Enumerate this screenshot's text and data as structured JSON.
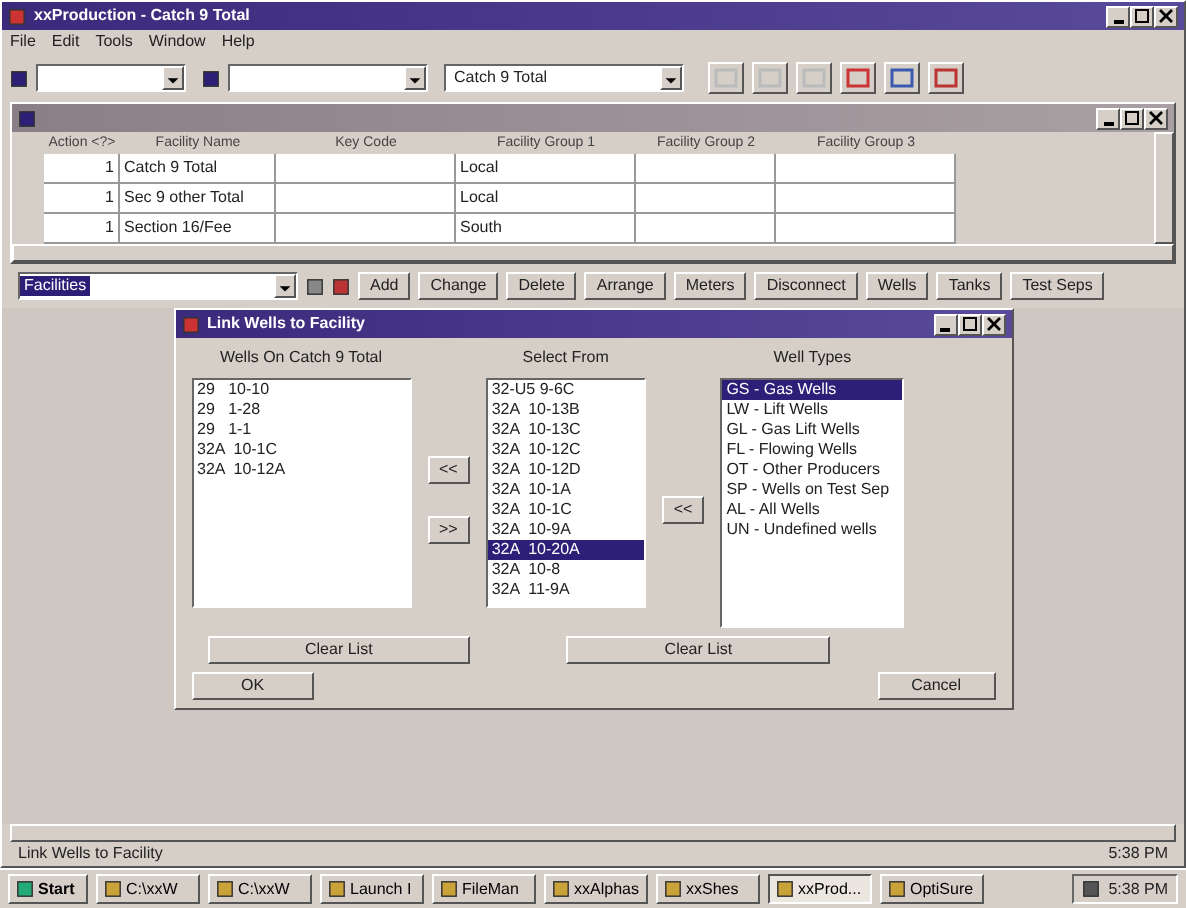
{
  "window": {
    "title": "xxProduction - Catch 9 Total"
  },
  "menu": [
    "File",
    "Edit",
    "Tools",
    "Window",
    "Help"
  ],
  "toolbar": {
    "combos": [
      {
        "kind": "blank"
      },
      {
        "kind": "blank"
      },
      {
        "kind": "text",
        "value": "Catch 9 Total"
      }
    ]
  },
  "grid": {
    "columns": [
      "Action <?>",
      "Facility Name",
      "Key Code",
      "Facility Group 1",
      "Facility Group 2",
      "Facility Group 3"
    ],
    "rows": [
      [
        "1",
        "Catch 9 Total",
        "",
        "Local",
        "",
        ""
      ],
      [
        "1",
        "Sec 9 other Total",
        "",
        "Local",
        "",
        ""
      ],
      [
        "1",
        "Section 16/Fee",
        "",
        "South",
        "",
        ""
      ]
    ]
  },
  "facility_bar": {
    "combo": "Facilities",
    "buttons": [
      "Add",
      "Change",
      "Delete",
      "Arrange",
      "Meters",
      "Disconnect",
      "Wells",
      "Tanks",
      "Test Seps"
    ]
  },
  "dialog": {
    "title": "Link Wells to Facility",
    "wells_on": {
      "header": "Wells On Catch 9 Total",
      "items": [
        {
          "text": "29   10-10",
          "selected": false
        },
        {
          "text": "29   1-28",
          "selected": false
        },
        {
          "text": "29   1-1",
          "selected": false
        },
        {
          "text": "32A  10-1C",
          "selected": false
        },
        {
          "text": "32A  10-12A",
          "selected": false
        }
      ]
    },
    "add_button": "<<",
    "remove_button": ">>",
    "select_from": {
      "header": "Select From",
      "items": [
        {
          "text": "32-U5 9-6C",
          "selected": false
        },
        {
          "text": "32A  10-13B",
          "selected": false
        },
        {
          "text": "32A  10-13C",
          "selected": false
        },
        {
          "text": "32A  10-12C",
          "selected": false
        },
        {
          "text": "32A  10-12D",
          "selected": false
        },
        {
          "text": "32A  10-1A",
          "selected": false
        },
        {
          "text": "32A  10-1C",
          "selected": false
        },
        {
          "text": "32A  10-9A",
          "selected": false
        },
        {
          "text": "32A  10-20A",
          "selected": true
        },
        {
          "text": "32A  10-8",
          "selected": false
        },
        {
          "text": "32A  11-9A",
          "selected": false
        }
      ]
    },
    "type_button": "<<",
    "well_types": {
      "header": "Well Types",
      "items": [
        {
          "text": "GS - Gas Wells",
          "selected": true
        },
        {
          "text": "LW - Lift Wells",
          "selected": false
        },
        {
          "text": "GL - Gas Lift Wells",
          "selected": false
        },
        {
          "text": "FL - Flowing Wells",
          "selected": false
        },
        {
          "text": "OT - Other Producers",
          "selected": false
        },
        {
          "text": "SP - Wells on Test Sep",
          "selected": false
        },
        {
          "text": "AL - All Wells",
          "selected": false
        },
        {
          "text": "UN - Undefined wells",
          "selected": false
        }
      ]
    },
    "clear_buttons": [
      "Clear List",
      "Clear List"
    ],
    "ok": "OK",
    "cancel": "Cancel"
  },
  "status_bar": {
    "text": "Link Wells to Facility",
    "time": "5:38 PM"
  },
  "taskbar": {
    "start": "Start",
    "items": [
      {
        "label": "C:\\xxW",
        "selected": false
      },
      {
        "label": "C:\\xxW",
        "selected": false
      },
      {
        "label": "Launch I",
        "selected": false
      },
      {
        "label": "FileMan",
        "selected": false
      },
      {
        "label": "xxAlphas",
        "selected": false
      },
      {
        "label": "xxShes",
        "selected": false
      },
      {
        "label": "xxProd...",
        "selected": true
      },
      {
        "label": "OptiSure",
        "selected": false
      }
    ],
    "clock": "5:38 PM"
  }
}
